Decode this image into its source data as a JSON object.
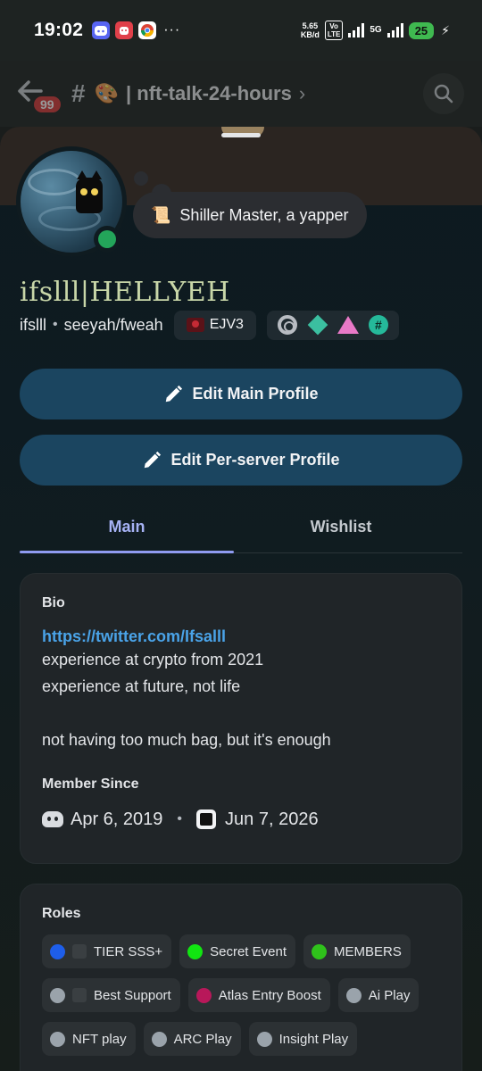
{
  "status_bar": {
    "time": "19:02",
    "network_speed": "5.65\nKB/d",
    "volte": "Vo\nLTE",
    "net_type": "5G",
    "battery": "25",
    "more": "···"
  },
  "channel_header": {
    "unread_badge": "99",
    "emoji": "🎨",
    "name": "| nft-talk-24-hours",
    "chevron": "›"
  },
  "profile": {
    "status_emoji": "📜",
    "status_text": "Shiller Master, a yapper",
    "display_name": "ifslll|HELLYEH",
    "username": "ifslll",
    "pronouns": "seeyah/fweah",
    "separator": "•",
    "server_tag": "EJV3",
    "badge_hash": "#"
  },
  "buttons": {
    "edit_main": "Edit Main Profile",
    "edit_per_server": "Edit Per-server Profile"
  },
  "tabs": [
    {
      "label": "Main",
      "active": true
    },
    {
      "label": "Wishlist",
      "active": false
    }
  ],
  "bio": {
    "title": "Bio",
    "link": "https://twitter.com/Ifsalll",
    "lines": [
      "experience at crypto from 2021",
      "experience at future, not life",
      "",
      "not having too much bag, but it's enough"
    ]
  },
  "member_since": {
    "title": "Member Since",
    "discord_date": "Apr 6, 2019",
    "separator": "•",
    "server_date": "Jun 7, 2026"
  },
  "roles": {
    "title": "Roles",
    "items": [
      {
        "label": "TIER SSS+",
        "color": "#1e5eea",
        "icon": true
      },
      {
        "label": "Secret Event",
        "color": "#11e511",
        "icon": false
      },
      {
        "label": "MEMBERS",
        "color": "#2fc21b",
        "icon": false
      },
      {
        "label": "Best Support",
        "color": "#9aa3ab",
        "icon": true
      },
      {
        "label": "Atlas Entry Boost",
        "color": "#b8185a",
        "icon": false
      },
      {
        "label": "Ai Play",
        "color": "#9aa3ab",
        "icon": false
      },
      {
        "label": "NFT play",
        "color": "#9aa3ab",
        "icon": false
      },
      {
        "label": "ARC Play",
        "color": "#9aa3ab",
        "icon": false
      },
      {
        "label": "Insight Play",
        "color": "#9aa3ab",
        "icon": false
      }
    ]
  }
}
